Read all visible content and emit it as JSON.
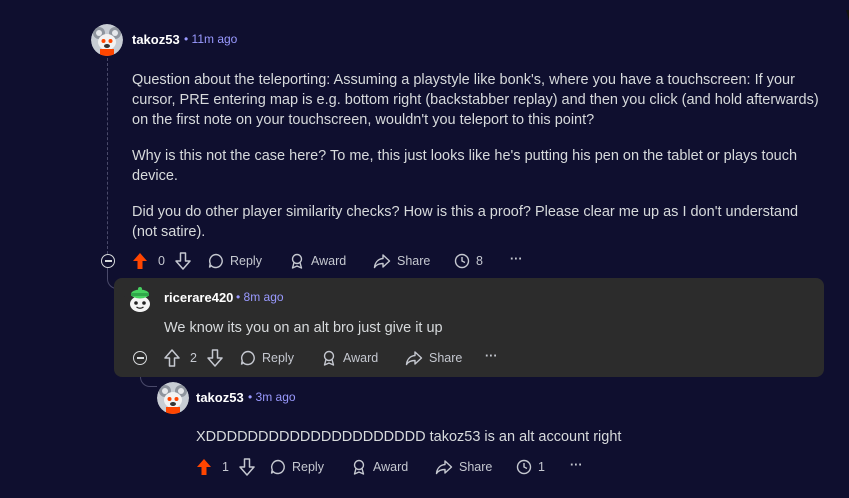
{
  "comments": [
    {
      "user": "takoz53",
      "time": "• 11m ago",
      "paragraphs": [
        "Question about the teleporting: Assuming a playstyle like bonk's, where you have a touchscreen: If your cursor, PRE entering map is e.g. bottom right (backstabber replay) and then you click (and hold afterwards) on the first note on your touchscreen, wouldn't you teleport to this point?",
        "Why is this not the case here? To me, this just looks like he's putting his pen on the tablet or plays touch device.",
        "Did you do other player similarity checks? How is this a proof? Please clear me up as I don't understand (not satire)."
      ],
      "score": "0",
      "reply": "Reply",
      "award": "Award",
      "share": "Share",
      "awards_count": "8",
      "more": "···"
    },
    {
      "user": "ricerare420",
      "time": "• 8m ago",
      "paragraphs": [
        "We know its you on an alt bro just give it up"
      ],
      "score": "2",
      "reply": "Reply",
      "award": "Award",
      "share": "Share",
      "more": "···"
    },
    {
      "user": "takoz53",
      "time": "• 3m ago",
      "paragraphs": [
        "XDDDDDDDDDDDDDDDDDDDDD takoz53 is an alt account right"
      ],
      "score": "1",
      "reply": "Reply",
      "award": "Award",
      "share": "Share",
      "awards_count": "1",
      "more": "···"
    }
  ],
  "colors": {
    "background": "#0f0f2f",
    "upvote_active": "#ff4500",
    "timestamp": "#9a9aff",
    "highlight": "#2c2c2c"
  }
}
